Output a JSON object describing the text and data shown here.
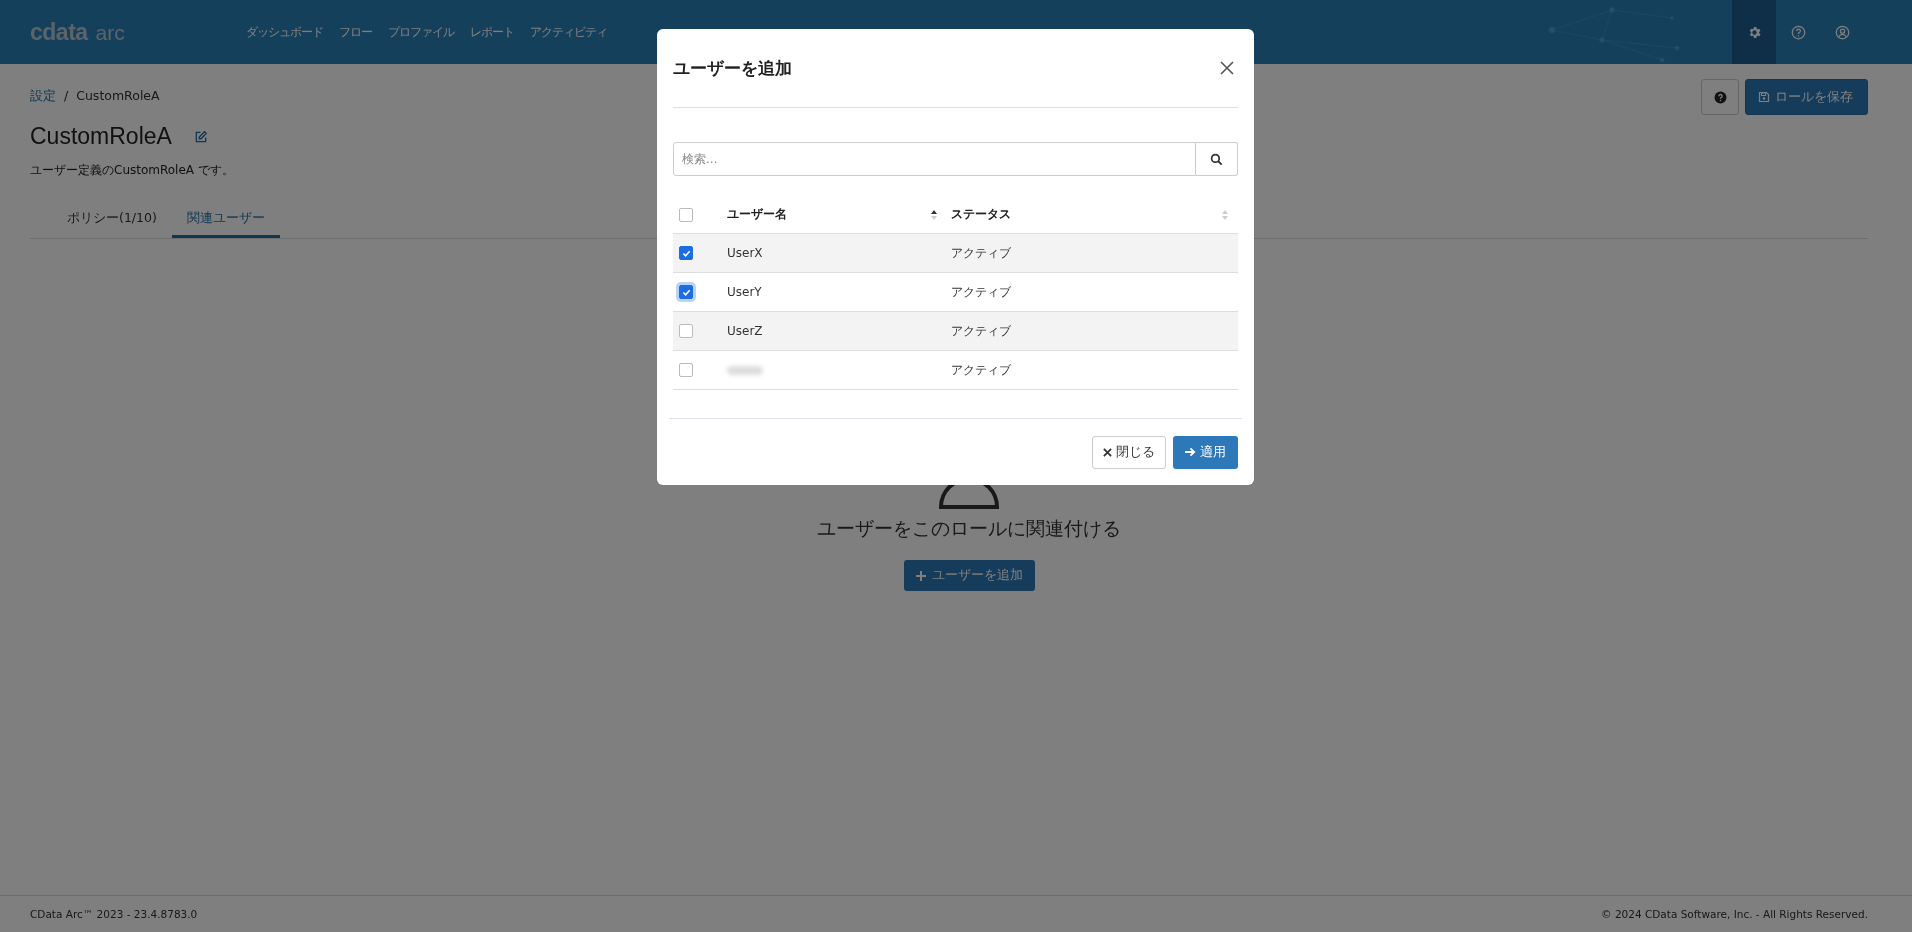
{
  "header": {
    "logo": {
      "brand": "cdata",
      "product": "arc"
    },
    "nav": [
      {
        "label": "ダッシュボード"
      },
      {
        "label": "フロー"
      },
      {
        "label": "プロファイル"
      },
      {
        "label": "レポート"
      },
      {
        "label": "アクティビティ"
      }
    ],
    "icons": [
      {
        "kind": "settings",
        "selected": true
      },
      {
        "kind": "help",
        "selected": false
      },
      {
        "kind": "user",
        "selected": false
      }
    ]
  },
  "breadcrumb": {
    "items": [
      "設定",
      "CustomRoleA"
    ],
    "separator": "/"
  },
  "title": "CustomRoleA",
  "description": "ユーザー定義のCustomRoleA です。",
  "actions": {
    "save": "ロールを保存"
  },
  "tabs": [
    {
      "label": "ポリシー(1/10)",
      "selected": false
    },
    {
      "label": "関連ユーザー",
      "selected": true
    }
  ],
  "empty_state": {
    "message": "ユーザーをこのロールに関連付ける",
    "button": "ユーザーを追加"
  },
  "footer": {
    "left": "CData Arc™ 2023 - 23.4.8783.0",
    "right": "© 2024 CData Software, Inc. - All Rights Reserved."
  },
  "modal": {
    "title": "ユーザーを追加",
    "search": {
      "placeholder": "検索..."
    },
    "table": {
      "select_all": false,
      "columns": [
        {
          "label": "ユーザー名",
          "sorted": true
        },
        {
          "label": "ステータス",
          "sorted": false
        }
      ],
      "rows": [
        {
          "name": "UserX",
          "status": "アクティブ",
          "checked": true,
          "redacted": false
        },
        {
          "name": "UserY",
          "status": "アクティブ",
          "checked": true,
          "redacted": false
        },
        {
          "name": "UserZ",
          "status": "アクティブ",
          "checked": false,
          "redacted": false
        },
        {
          "status": "アクティブ",
          "checked": false,
          "redacted": true
        }
      ]
    },
    "buttons": {
      "close": "閉じる",
      "apply": "適用"
    }
  }
}
